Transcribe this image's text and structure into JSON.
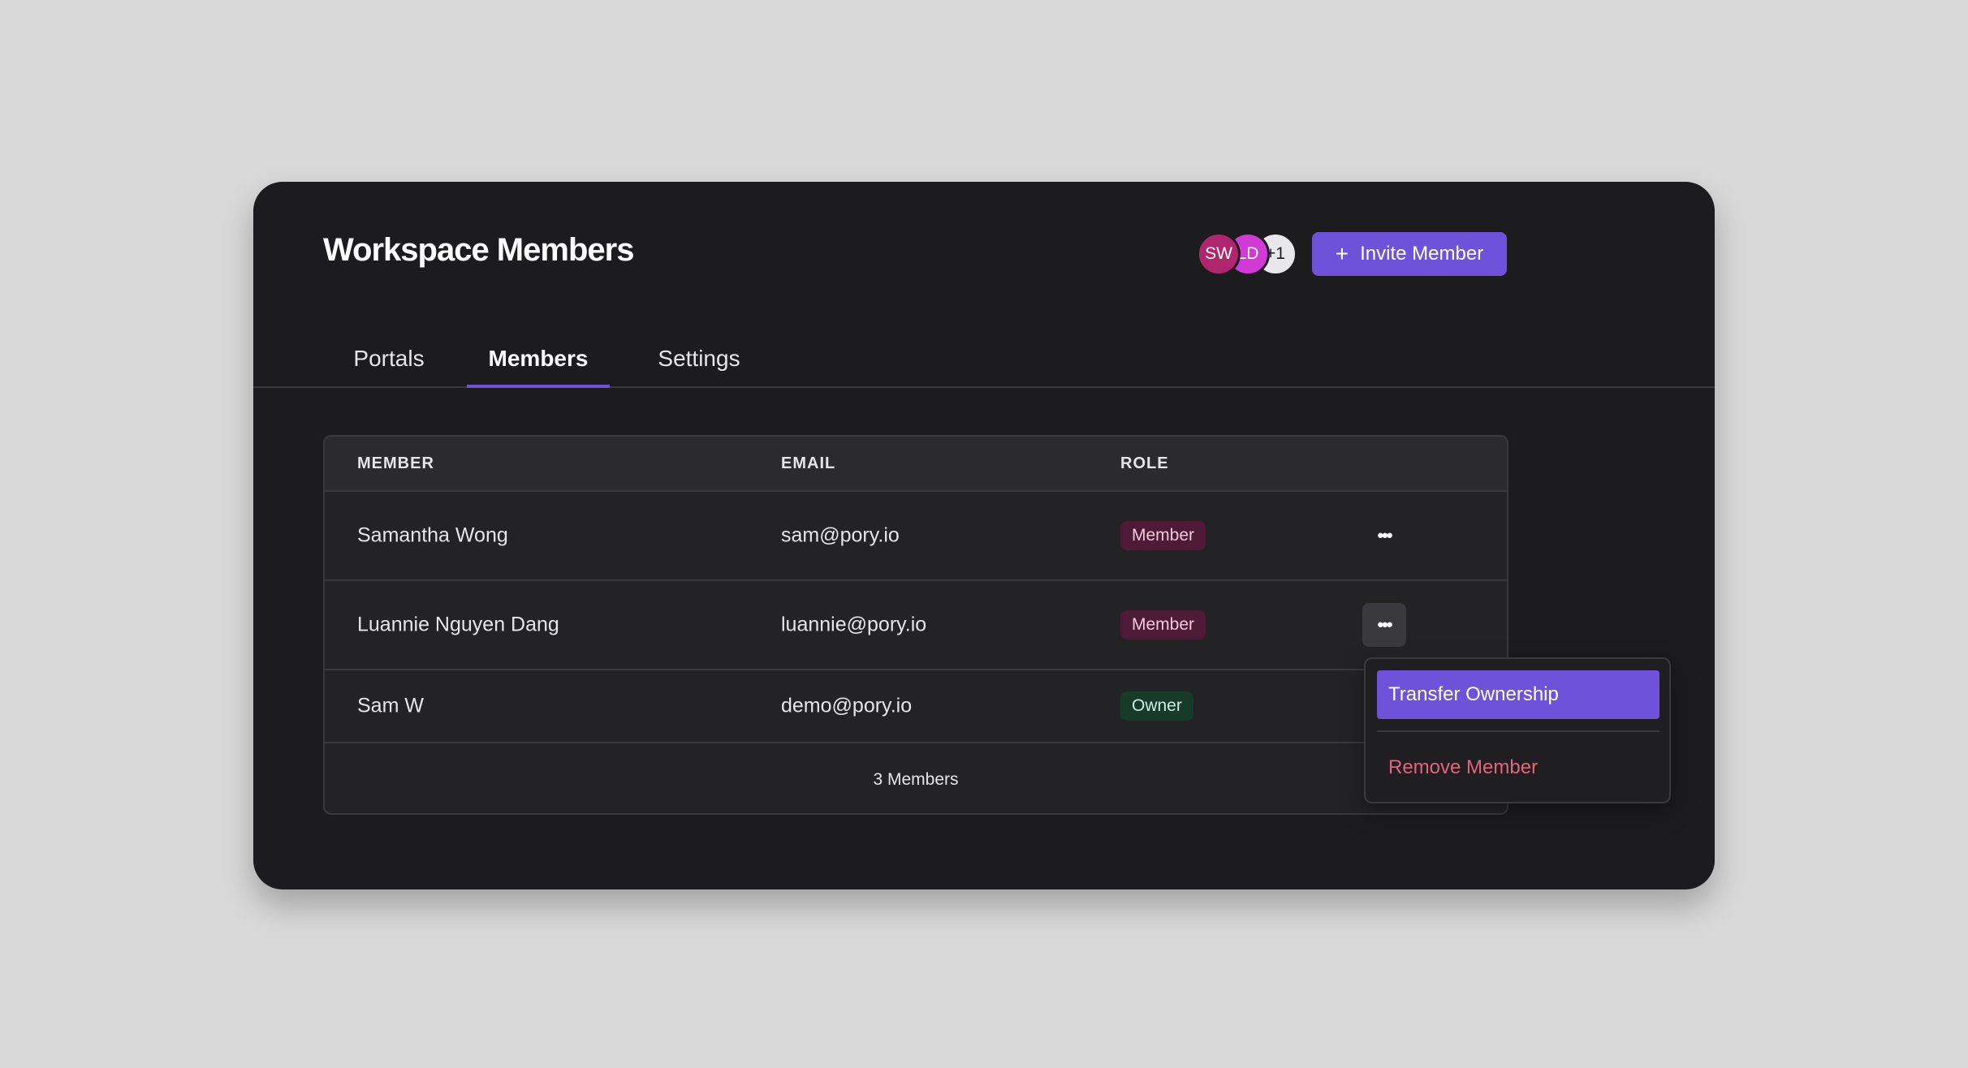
{
  "header": {
    "title": "Workspace Members",
    "avatars": [
      "SW",
      "LD",
      "+1"
    ],
    "invite_label": "Invite Member",
    "invite_icon": "+"
  },
  "tabs": [
    {
      "label": "Portals",
      "active": false
    },
    {
      "label": "Members",
      "active": true
    },
    {
      "label": "Settings",
      "active": false
    }
  ],
  "table": {
    "columns": [
      "MEMBER",
      "EMAIL",
      "ROLE"
    ],
    "rows": [
      {
        "name": "Samantha Wong",
        "email": "sam@pory.io",
        "role": "Member"
      },
      {
        "name": "Luannie Nguyen Dang",
        "email": "luannie@pory.io",
        "role": "Member"
      },
      {
        "name": "Sam W",
        "email": "demo@pory.io",
        "role": "Owner"
      }
    ],
    "more_icon": "•••",
    "footer": "3 Members"
  },
  "menu": {
    "transfer_label": "Transfer Ownership",
    "remove_label": "Remove Member"
  },
  "colors": {
    "accent": "#6e52d9",
    "member_badge_bg": "#4e1a35",
    "owner_badge_bg": "#163b2b",
    "danger": "#e0657d"
  }
}
